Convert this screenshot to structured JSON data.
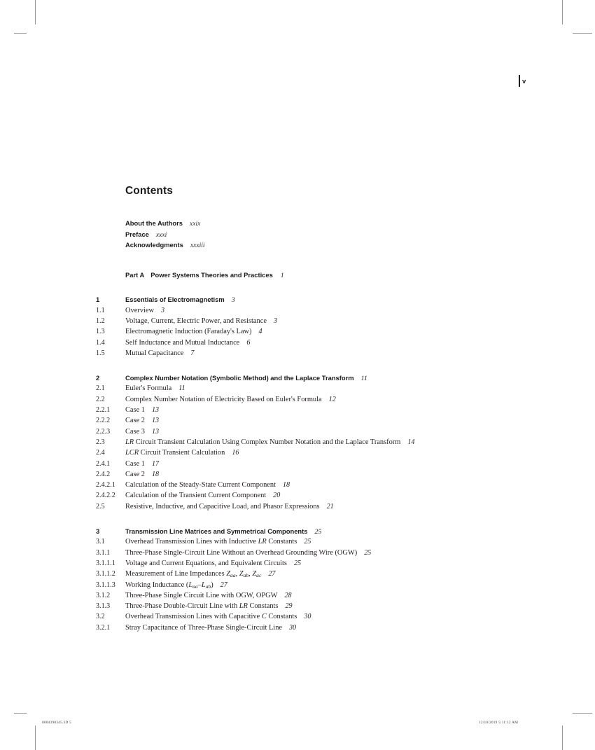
{
  "folio": {
    "page_number": "v"
  },
  "page_title": "Contents",
  "front_matter": [
    {
      "label": "About the Authors",
      "page": "xxix"
    },
    {
      "label": "Preface",
      "page": "xxxi"
    },
    {
      "label": "Acknowledgments",
      "page": "xxxiii"
    }
  ],
  "part": {
    "label": "Part A",
    "title": "Power Systems Theories and Practices",
    "page": "1"
  },
  "chapters": [
    {
      "number": "1",
      "title": "Essentials of Electromagnetism",
      "page": "3",
      "entries": [
        {
          "number": "1.1",
          "text": "Overview",
          "page": "3"
        },
        {
          "number": "1.2",
          "text": "Voltage, Current, Electric Power, and Resistance",
          "page": "3"
        },
        {
          "number": "1.3",
          "text": "Electromagnetic Induction (Faraday's Law)",
          "page": "4"
        },
        {
          "number": "1.4",
          "text": "Self Inductance and Mutual Inductance",
          "page": "6"
        },
        {
          "number": "1.5",
          "text": "Mutual Capacitance",
          "page": "7"
        }
      ]
    },
    {
      "number": "2",
      "title": "Complex Number Notation (Symbolic Method) and the Laplace Transform",
      "page": "11",
      "entries": [
        {
          "number": "2.1",
          "text": "Euler's Formula",
          "page": "11"
        },
        {
          "number": "2.2",
          "text": "Complex Number Notation of Electricity Based on Euler's Formula",
          "page": "12"
        },
        {
          "number": "2.2.1",
          "text": "Case 1",
          "page": "13"
        },
        {
          "number": "2.2.2",
          "text": "Case 2",
          "page": "13"
        },
        {
          "number": "2.2.3",
          "text": "Case 3",
          "page": "13"
        },
        {
          "number": "2.3",
          "html": "<i>LR</i> Circuit Transient Calculation Using Complex Number Notation and the Laplace Transform",
          "text": "LR Circuit Transient Calculation Using Complex Number Notation and the Laplace Transform",
          "page": "14"
        },
        {
          "number": "2.4",
          "html": "<i>LCR</i> Circuit Transient Calculation",
          "text": "LCR Circuit Transient Calculation",
          "page": "16"
        },
        {
          "number": "2.4.1",
          "text": "Case 1",
          "page": "17"
        },
        {
          "number": "2.4.2",
          "text": "Case 2",
          "page": "18"
        },
        {
          "number": "2.4.2.1",
          "text": "Calculation of the Steady-State Current Component",
          "page": "18"
        },
        {
          "number": "2.4.2.2",
          "text": "Calculation of the Transient Current Component",
          "page": "20"
        },
        {
          "number": "2.5",
          "text": "Resistive, Inductive, and Capacitive Load, and Phasor Expressions",
          "page": "21"
        }
      ]
    },
    {
      "number": "3",
      "title": "Transmission Line Matrices and Symmetrical Components",
      "page": "25",
      "entries": [
        {
          "number": "3.1",
          "html": "Overhead Transmission Lines with Inductive <i>LR</i> Constants",
          "text": "Overhead Transmission Lines with Inductive LR Constants",
          "page": "25"
        },
        {
          "number": "3.1.1",
          "text": "Three-Phase Single-Circuit Line Without an Overhead Grounding Wire (OGW)",
          "page": "25"
        },
        {
          "number": "3.1.1.1",
          "text": "Voltage and Current Equations, and Equivalent Circuits",
          "page": "25"
        },
        {
          "number": "3.1.1.2",
          "html": "Measurement of Line Impedances <i>Z</i><sub>aa</sub>, <i>Z</i><sub>ab</sub>, <i>Z</i><sub>ac</sub>",
          "text": "Measurement of Line Impedances Zaa, Zab, Zac",
          "page": "27"
        },
        {
          "number": "3.1.1.3",
          "html": "Working Inductance (<i>L</i><sub>aa</sub>&#8211;<i>L</i><sub>ab</sub>)",
          "text": "Working Inductance (Laa-Lab)",
          "page": "27"
        },
        {
          "number": "3.1.2",
          "text": "Three-Phase Single Circuit Line with OGW, OPGW",
          "page": "28"
        },
        {
          "number": "3.1.3",
          "html": "Three-Phase Double-Circuit Line with <i>LR</i> Constants",
          "text": "Three-Phase Double-Circuit Line with LR Constants",
          "page": "29"
        },
        {
          "number": "3.2",
          "html": "Overhead Transmission Lines with Capacitive <i>C</i> Constants",
          "text": "Overhead Transmission Lines with Capacitive C Constants",
          "page": "30"
        },
        {
          "number": "3.2.1",
          "text": "Stray Capacitance of Three-Phase Single-Circuit Line",
          "page": "30"
        }
      ]
    }
  ],
  "footer": {
    "job_id": "0004390345.3D   5",
    "timestamp": "12/10/2019   5:11:12 AM"
  }
}
